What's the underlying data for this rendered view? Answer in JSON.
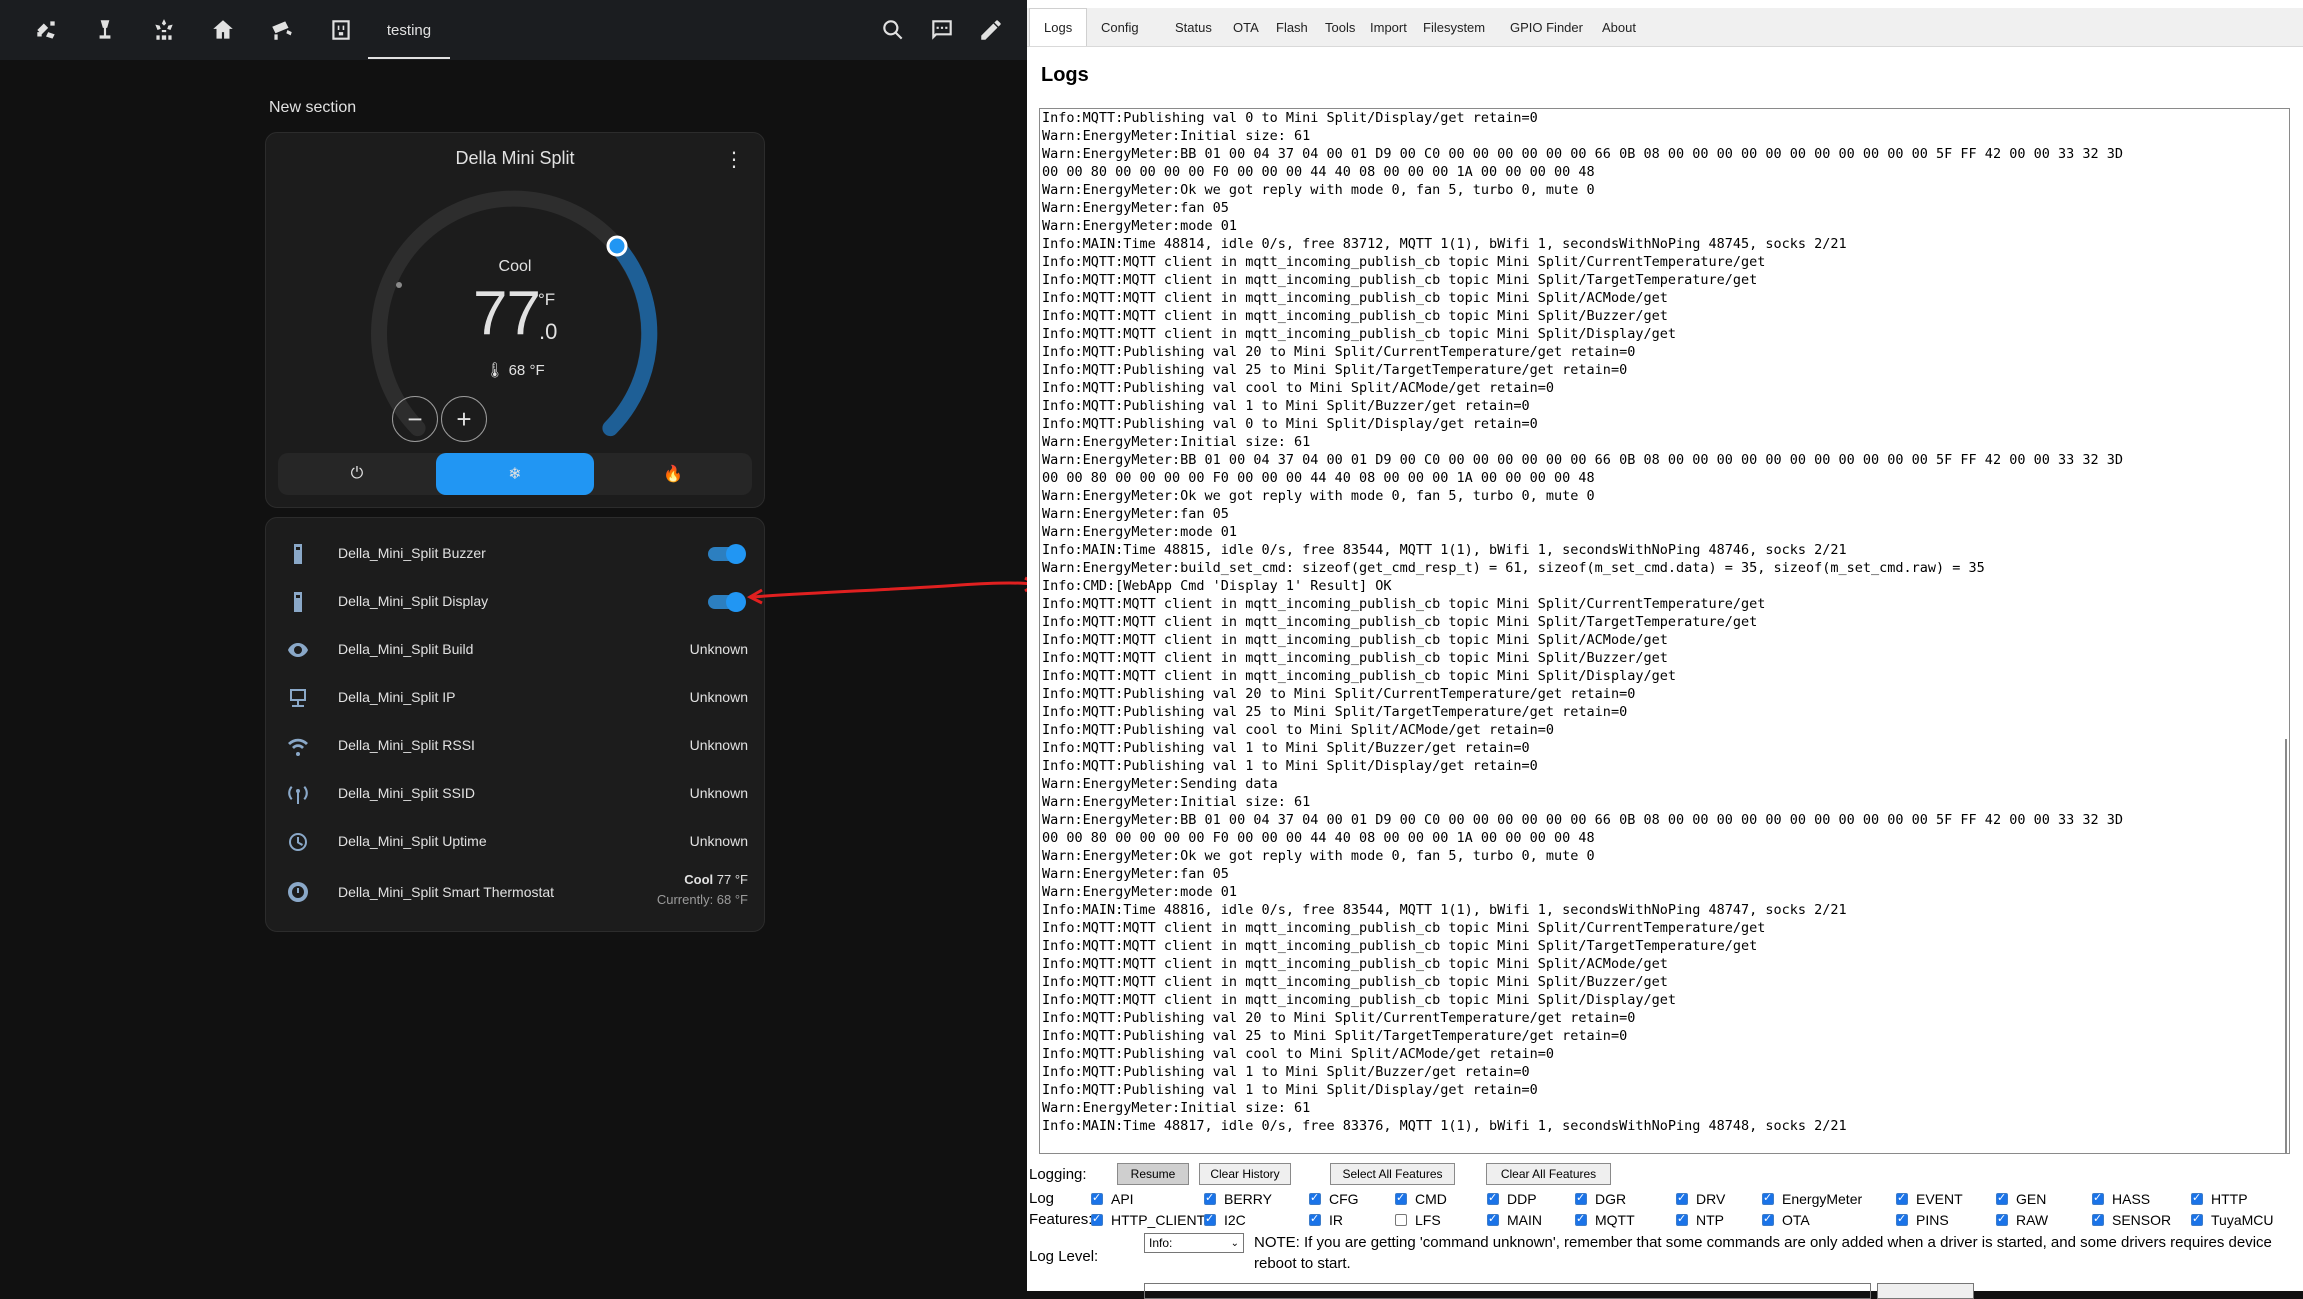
{
  "ha": {
    "topbar": {
      "icons": [
        "robot-vacuum-icon",
        "desk-lamp-icon",
        "air-conditioner-icon",
        "home-icon",
        "cctv-icon",
        "power-socket-icon"
      ],
      "active_tab": "testing",
      "right_icons": [
        "search-icon",
        "assist-chat-icon",
        "edit-pencil-icon"
      ]
    },
    "section_title": "New section",
    "thermostat": {
      "name": "Della Mini Split",
      "mode": "Cool",
      "target_int": "77",
      "target_dec": ".0",
      "unit": "°F",
      "current": "68 °F",
      "minus": "−",
      "plus": "+",
      "target_fraction": 0.78,
      "mode_buttons": [
        "power-icon",
        "snowflake-icon",
        "flame-icon"
      ]
    },
    "entities": [
      {
        "name": "Della_Mini_Split Buzzer",
        "icon": "remote-icon",
        "type": "toggle",
        "on": true
      },
      {
        "name": "Della_Mini_Split Display",
        "icon": "remote-icon",
        "type": "toggle",
        "on": true
      },
      {
        "name": "Della_Mini_Split Build",
        "icon": "eye-icon",
        "value": "Unknown"
      },
      {
        "name": "Della_Mini_Split IP",
        "icon": "ip-network-icon",
        "value": "Unknown"
      },
      {
        "name": "Della_Mini_Split RSSI",
        "icon": "wifi-icon",
        "value": "Unknown"
      },
      {
        "name": "Della_Mini_Split SSID",
        "icon": "access-point-icon",
        "value": "Unknown"
      },
      {
        "name": "Della_Mini_Split Uptime",
        "icon": "clock-history-icon",
        "value": "Unknown"
      },
      {
        "name": "Della_Mini_Split Smart Thermostat",
        "icon": "thermostat-icon",
        "state_mode": "Cool",
        "state_temp": "77 °F",
        "state_sub": "Currently: 68 °F"
      }
    ]
  },
  "web": {
    "tabs": [
      "Logs",
      "Config",
      "Status",
      "OTA",
      "Flash",
      "Tools",
      "Import",
      "Filesystem",
      "GPIO Finder",
      "About"
    ],
    "heading": "Logs",
    "log_lines": [
      "Info:MQTT:Publishing val 0 to Mini Split/Display/get retain=0",
      "Warn:EnergyMeter:Initial size: 61",
      "Warn:EnergyMeter:BB 01 00 04 37 04 00 01 D9 00 C0 00 00 00 00 00 00 66 0B 08 00 00 00 00 00 00 00 00 00 00 00 5F FF 42 00 00 33 32 3D",
      "00 00 80 00 00 00 00 F0 00 00 00 44 40 08 00 00 00 1A 00 00 00 00 48",
      "Warn:EnergyMeter:Ok we got reply with mode 0, fan 5, turbo 0, mute 0",
      "Warn:EnergyMeter:fan 05",
      "Warn:EnergyMeter:mode 01",
      "Info:MAIN:Time 48814, idle 0/s, free 83712, MQTT 1(1), bWifi 1, secondsWithNoPing 48745, socks 2/21",
      "Info:MQTT:MQTT client in mqtt_incoming_publish_cb topic Mini Split/CurrentTemperature/get",
      "Info:MQTT:MQTT client in mqtt_incoming_publish_cb topic Mini Split/TargetTemperature/get",
      "Info:MQTT:MQTT client in mqtt_incoming_publish_cb topic Mini Split/ACMode/get",
      "Info:MQTT:MQTT client in mqtt_incoming_publish_cb topic Mini Split/Buzzer/get",
      "Info:MQTT:MQTT client in mqtt_incoming_publish_cb topic Mini Split/Display/get",
      "Info:MQTT:Publishing val 20 to Mini Split/CurrentTemperature/get retain=0",
      "Info:MQTT:Publishing val 25 to Mini Split/TargetTemperature/get retain=0",
      "Info:MQTT:Publishing val cool to Mini Split/ACMode/get retain=0",
      "Info:MQTT:Publishing val 1 to Mini Split/Buzzer/get retain=0",
      "Info:MQTT:Publishing val 0 to Mini Split/Display/get retain=0",
      "Warn:EnergyMeter:Initial size: 61",
      "Warn:EnergyMeter:BB 01 00 04 37 04 00 01 D9 00 C0 00 00 00 00 00 00 66 0B 08 00 00 00 00 00 00 00 00 00 00 00 5F FF 42 00 00 33 32 3D",
      "00 00 80 00 00 00 00 F0 00 00 00 44 40 08 00 00 00 1A 00 00 00 00 48",
      "Warn:EnergyMeter:Ok we got reply with mode 0, fan 5, turbo 0, mute 0",
      "Warn:EnergyMeter:fan 05",
      "Warn:EnergyMeter:mode 01",
      "Info:MAIN:Time 48815, idle 0/s, free 83544, MQTT 1(1), bWifi 1, secondsWithNoPing 48746, socks 2/21",
      "Warn:EnergyMeter:build_set_cmd: sizeof(get_cmd_resp_t) = 61, sizeof(m_set_cmd.data) = 35, sizeof(m_set_cmd.raw) = 35",
      "Info:CMD:[WebApp Cmd 'Display 1' Result] OK",
      "Info:MQTT:MQTT client in mqtt_incoming_publish_cb topic Mini Split/CurrentTemperature/get",
      "Info:MQTT:MQTT client in mqtt_incoming_publish_cb topic Mini Split/TargetTemperature/get",
      "Info:MQTT:MQTT client in mqtt_incoming_publish_cb topic Mini Split/ACMode/get",
      "Info:MQTT:MQTT client in mqtt_incoming_publish_cb topic Mini Split/Buzzer/get",
      "Info:MQTT:MQTT client in mqtt_incoming_publish_cb topic Mini Split/Display/get",
      "Info:MQTT:Publishing val 20 to Mini Split/CurrentTemperature/get retain=0",
      "Info:MQTT:Publishing val 25 to Mini Split/TargetTemperature/get retain=0",
      "Info:MQTT:Publishing val cool to Mini Split/ACMode/get retain=0",
      "Info:MQTT:Publishing val 1 to Mini Split/Buzzer/get retain=0",
      "Info:MQTT:Publishing val 1 to Mini Split/Display/get retain=0",
      "Warn:EnergyMeter:Sending data",
      "Warn:EnergyMeter:Initial size: 61",
      "Warn:EnergyMeter:BB 01 00 04 37 04 00 01 D9 00 C0 00 00 00 00 00 00 66 0B 08 00 00 00 00 00 00 00 00 00 00 00 5F FF 42 00 00 33 32 3D",
      "00 00 80 00 00 00 00 F0 00 00 00 44 40 08 00 00 00 1A 00 00 00 00 48",
      "Warn:EnergyMeter:Ok we got reply with mode 0, fan 5, turbo 0, mute 0",
      "Warn:EnergyMeter:fan 05",
      "Warn:EnergyMeter:mode 01",
      "Info:MAIN:Time 48816, idle 0/s, free 83544, MQTT 1(1), bWifi 1, secondsWithNoPing 48747, socks 2/21",
      "Info:MQTT:MQTT client in mqtt_incoming_publish_cb topic Mini Split/CurrentTemperature/get",
      "Info:MQTT:MQTT client in mqtt_incoming_publish_cb topic Mini Split/TargetTemperature/get",
      "Info:MQTT:MQTT client in mqtt_incoming_publish_cb topic Mini Split/ACMode/get",
      "Info:MQTT:MQTT client in mqtt_incoming_publish_cb topic Mini Split/Buzzer/get",
      "Info:MQTT:MQTT client in mqtt_incoming_publish_cb topic Mini Split/Display/get",
      "Info:MQTT:Publishing val 20 to Mini Split/CurrentTemperature/get retain=0",
      "Info:MQTT:Publishing val 25 to Mini Split/TargetTemperature/get retain=0",
      "Info:MQTT:Publishing val cool to Mini Split/ACMode/get retain=0",
      "Info:MQTT:Publishing val 1 to Mini Split/Buzzer/get retain=0",
      "Info:MQTT:Publishing val 1 to Mini Split/Display/get retain=0",
      "Warn:EnergyMeter:Initial size: 61",
      "Info:MAIN:Time 48817, idle 0/s, free 83376, MQTT 1(1), bWifi 1, secondsWithNoPing 48748, socks 2/21"
    ],
    "logging_label": "Logging:",
    "buttons": {
      "resume": "Resume",
      "clear_history": "Clear History",
      "select_all": "Select All Features",
      "clear_all": "Clear All Features"
    },
    "log_features_label_1": "Log",
    "log_features_label_2": "Features:",
    "features_row1": [
      {
        "name": "API",
        "checked": true
      },
      {
        "name": "BERRY",
        "checked": true
      },
      {
        "name": "CFG",
        "checked": true
      },
      {
        "name": "CMD",
        "checked": true
      },
      {
        "name": "DDP",
        "checked": true
      },
      {
        "name": "DGR",
        "checked": true
      },
      {
        "name": "DRV",
        "checked": true
      },
      {
        "name": "EnergyMeter",
        "checked": true
      },
      {
        "name": "EVENT",
        "checked": true
      },
      {
        "name": "GEN",
        "checked": true
      },
      {
        "name": "HASS",
        "checked": true
      },
      {
        "name": "HTTP",
        "checked": true
      }
    ],
    "features_row2": [
      {
        "name": "HTTP_CLIENT",
        "checked": true
      },
      {
        "name": "I2C",
        "checked": true
      },
      {
        "name": "IR",
        "checked": true
      },
      {
        "name": "LFS",
        "checked": false
      },
      {
        "name": "MAIN",
        "checked": true
      },
      {
        "name": "MQTT",
        "checked": true
      },
      {
        "name": "NTP",
        "checked": true
      },
      {
        "name": "OTA",
        "checked": true
      },
      {
        "name": "PINS",
        "checked": true
      },
      {
        "name": "RAW",
        "checked": true
      },
      {
        "name": "SENSOR",
        "checked": true
      },
      {
        "name": "TuyaMCU",
        "checked": true
      }
    ],
    "log_level_label": "Log Level:",
    "log_level_value": "Info:",
    "note": "NOTE: If you are getting 'command unknown', remember that some commands are only added when a driver is started, and some drivers requires device reboot to start."
  }
}
